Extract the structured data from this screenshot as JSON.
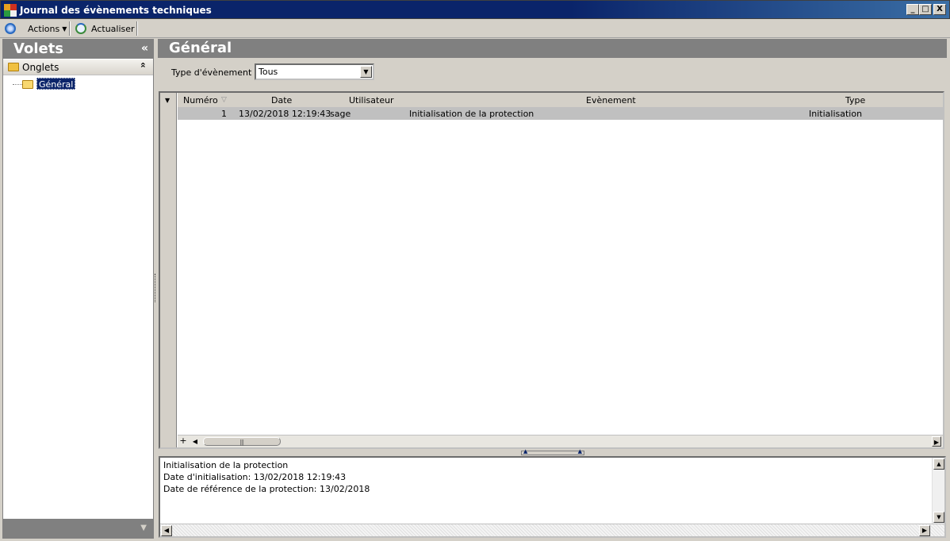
{
  "window": {
    "title": "Journal des évènements techniques",
    "minimize": "_",
    "maximize": "□",
    "close": "X"
  },
  "toolbar": {
    "actions_label": "Actions",
    "refresh_label": "Actualiser"
  },
  "left": {
    "title": "Volets",
    "collapse_glyph": "«",
    "group_label": "Onglets",
    "group_chevron": "⌃",
    "tree_item": "Général"
  },
  "main": {
    "title": "Général",
    "filter": {
      "label": "Type d'évènement :",
      "value": "Tous"
    },
    "grid": {
      "columns": [
        "Numéro",
        "Date",
        "Utilisateur",
        "Evènement",
        "Type"
      ],
      "rows": [
        {
          "numero": "1",
          "date": "13/02/2018 12:19:43",
          "utilisateur": "sage",
          "evenement": "Initialisation de la protection",
          "type": "Initialisation"
        }
      ]
    },
    "detail": {
      "lines": [
        "Initialisation de la protection",
        "Date d'initialisation: 13/02/2018 12:19:43",
        "Date de référence de la protection: 13/02/2018"
      ]
    }
  },
  "colors": {
    "titlebar": "#0a246a",
    "pane_header": "#808080",
    "selected_row": "#c0c0c0"
  }
}
